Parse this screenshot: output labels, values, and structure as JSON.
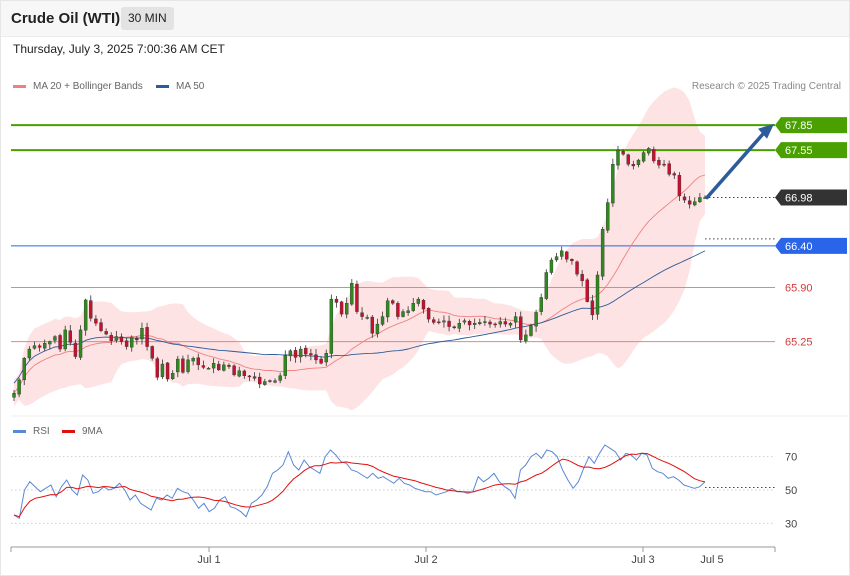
{
  "header": {
    "title": "Crude Oil (WTI)",
    "interval": "30 MIN",
    "datetime": "Thursday, July 3, 2025 7:00:36 AM CET"
  },
  "credit": "Research © 2025 Trading Central",
  "legend_main": [
    {
      "label": "MA 20 + Bollinger Bands",
      "color": "#f08080"
    },
    {
      "label": "MA 50",
      "color": "#2e5b9a"
    }
  ],
  "legend_rsi": [
    {
      "label": "RSI",
      "color": "#5a87d6"
    },
    {
      "label": "9MA",
      "color": "#e01010"
    }
  ],
  "chart_data": {
    "type": "candlestick",
    "price_axis": {
      "min": 64.5,
      "max": 68.2
    },
    "levels": [
      {
        "value": 67.85,
        "label": "67.85",
        "kind": "resistance",
        "color": "#4aa000"
      },
      {
        "value": 67.55,
        "label": "67.55",
        "kind": "resistance",
        "color": "#4aa000"
      },
      {
        "value": 66.98,
        "label": "66.98",
        "kind": "last",
        "color": "#333333"
      },
      {
        "value": 66.4,
        "label": "66.40",
        "kind": "pivot",
        "color": "#2a64e8"
      },
      {
        "value": 65.9,
        "label": "65.90",
        "kind": "support",
        "color": "#f08080"
      },
      {
        "value": 65.25,
        "label": "65.25",
        "kind": "support",
        "color": "#f08080"
      }
    ],
    "x_labels": [
      "Jul 1",
      "Jul 2",
      "Jul 3",
      "Jul 5"
    ],
    "closes": [
      64.63,
      64.79,
      65.05,
      65.16,
      65.2,
      65.18,
      65.23,
      65.25,
      65.31,
      65.16,
      65.39,
      65.24,
      65.07,
      65.39,
      65.75,
      65.53,
      65.47,
      65.38,
      65.34,
      65.26,
      65.31,
      65.25,
      65.19,
      65.3,
      65.27,
      65.41,
      65.19,
      65.05,
      64.82,
      64.98,
      64.8,
      64.87,
      65.04,
      64.88,
      65.03,
      65.05,
      64.97,
      64.94,
      64.93,
      64.99,
      64.91,
      64.97,
      64.95,
      64.85,
      64.9,
      64.84,
      64.83,
      64.81,
      64.74,
      64.77,
      64.77,
      64.78,
      64.84,
      65.08,
      65.14,
      65.06,
      65.16,
      65.1,
      65.09,
      65.03,
      64.99,
      65.11,
      65.76,
      65.72,
      65.58,
      65.71,
      65.95,
      65.61,
      65.55,
      65.54,
      65.35,
      65.46,
      65.55,
      65.74,
      65.71,
      65.55,
      65.61,
      65.62,
      65.71,
      65.76,
      65.64,
      65.52,
      65.48,
      65.48,
      65.5,
      65.43,
      65.42,
      65.47,
      65.5,
      65.45,
      65.47,
      65.48,
      65.49,
      65.46,
      65.45,
      65.49,
      65.46,
      65.47,
      65.55,
      65.27,
      65.33,
      65.44,
      65.6,
      65.78,
      66.08,
      66.23,
      66.27,
      66.34,
      66.24,
      66.22,
      66.06,
      65.98,
      65.73,
      65.57,
      66.05,
      66.6,
      66.92,
      67.38,
      67.55,
      67.5,
      67.38,
      67.36,
      67.43,
      67.52,
      67.57,
      67.42,
      67.37,
      67.38,
      67.26,
      67.25,
      67.0,
      66.95,
      66.9,
      66.93,
      66.98,
      66.98
    ]
  },
  "rsi_data": {
    "axis": {
      "min": 20,
      "max": 80
    },
    "ticks": [
      "70",
      "50",
      "30"
    ],
    "rsi": [
      35,
      33,
      50,
      55,
      52,
      49,
      51,
      53,
      46,
      52,
      56,
      50,
      47,
      59,
      56,
      48,
      49,
      52,
      50,
      51,
      54,
      50,
      44,
      47,
      42,
      40,
      38,
      45,
      44,
      47,
      45,
      51,
      49,
      48,
      44,
      39,
      42,
      37,
      39,
      44,
      46,
      40,
      39,
      37,
      34,
      42,
      44,
      47,
      52,
      60,
      62,
      65,
      73,
      65,
      62,
      68,
      64,
      62,
      60,
      70,
      74,
      71,
      67,
      66,
      62,
      61,
      59,
      57,
      60,
      57,
      58,
      56,
      54,
      57,
      54,
      53,
      51,
      50,
      49,
      49,
      47,
      48,
      49,
      51,
      49,
      49,
      48,
      49,
      58,
      55,
      57,
      60,
      55,
      52,
      50,
      45,
      62,
      65,
      70,
      72,
      69,
      74,
      73,
      70,
      62,
      56,
      51,
      55,
      63,
      70,
      66,
      72,
      77,
      75,
      73,
      68,
      72,
      71,
      68,
      72,
      71,
      63,
      61,
      60,
      57,
      58,
      56,
      53,
      52,
      51,
      52,
      55
    ]
  }
}
